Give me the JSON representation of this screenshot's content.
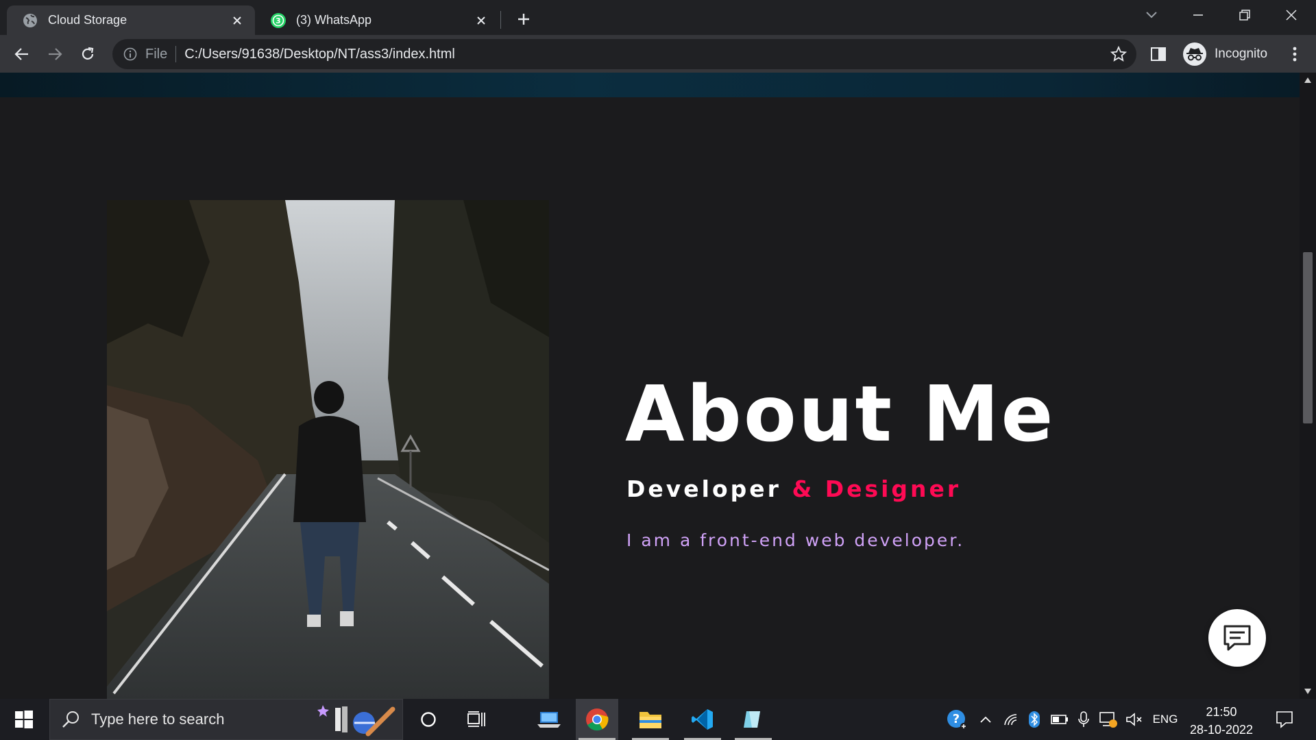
{
  "browser": {
    "tabs": [
      {
        "title": "Cloud Storage",
        "icon": "globe-icon",
        "active": true
      },
      {
        "title": "(3) WhatsApp",
        "icon": "whatsapp-icon",
        "badge": "3",
        "active": false
      }
    ],
    "omnibox": {
      "scheme_label": "File",
      "url": "C:/Users/91638/Desktop/NT/ass3/index.html"
    },
    "profile_label": "Incognito"
  },
  "page": {
    "about": {
      "title": "About Me",
      "role_primary": "Developer",
      "role_accent": "& Designer",
      "description": "I am a front-end web developer."
    },
    "colors": {
      "background": "#1b1b1d",
      "accent": "#ff0a54",
      "description": "#d0a2f7"
    }
  },
  "taskbar": {
    "search_placeholder": "Type here to search",
    "language": "ENG",
    "time": "21:50",
    "date": "28-10-2022"
  }
}
